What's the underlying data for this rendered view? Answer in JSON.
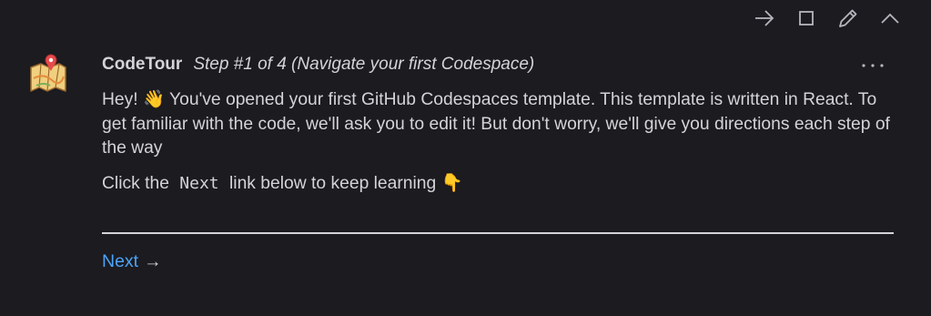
{
  "toolbar": {
    "icons": [
      "arrow-right-icon",
      "square-icon",
      "pencil-icon",
      "chevron-up-icon"
    ]
  },
  "comment": {
    "author": "CodeTour",
    "title": "Step #1 of 4 (Navigate your first Codespace)",
    "more_label": "···",
    "paragraph1_part1": "Hey! ",
    "paragraph1_emoji": "👋",
    "paragraph1_part2": " You've opened your first GitHub Codespaces template. This template is written in React. To get familiar with the code, we'll ask you to edit it! But don't worry, we'll give you directions each step of the way",
    "paragraph2_before": "Click the",
    "paragraph2_code": "Next",
    "paragraph2_after": "link below to keep learning ",
    "paragraph2_emoji": "👇"
  },
  "footer": {
    "next_label": "Next",
    "next_arrow": "→"
  },
  "colors": {
    "background": "#1b1b20",
    "text": "#d4d4d8",
    "link": "#4da3f7"
  }
}
